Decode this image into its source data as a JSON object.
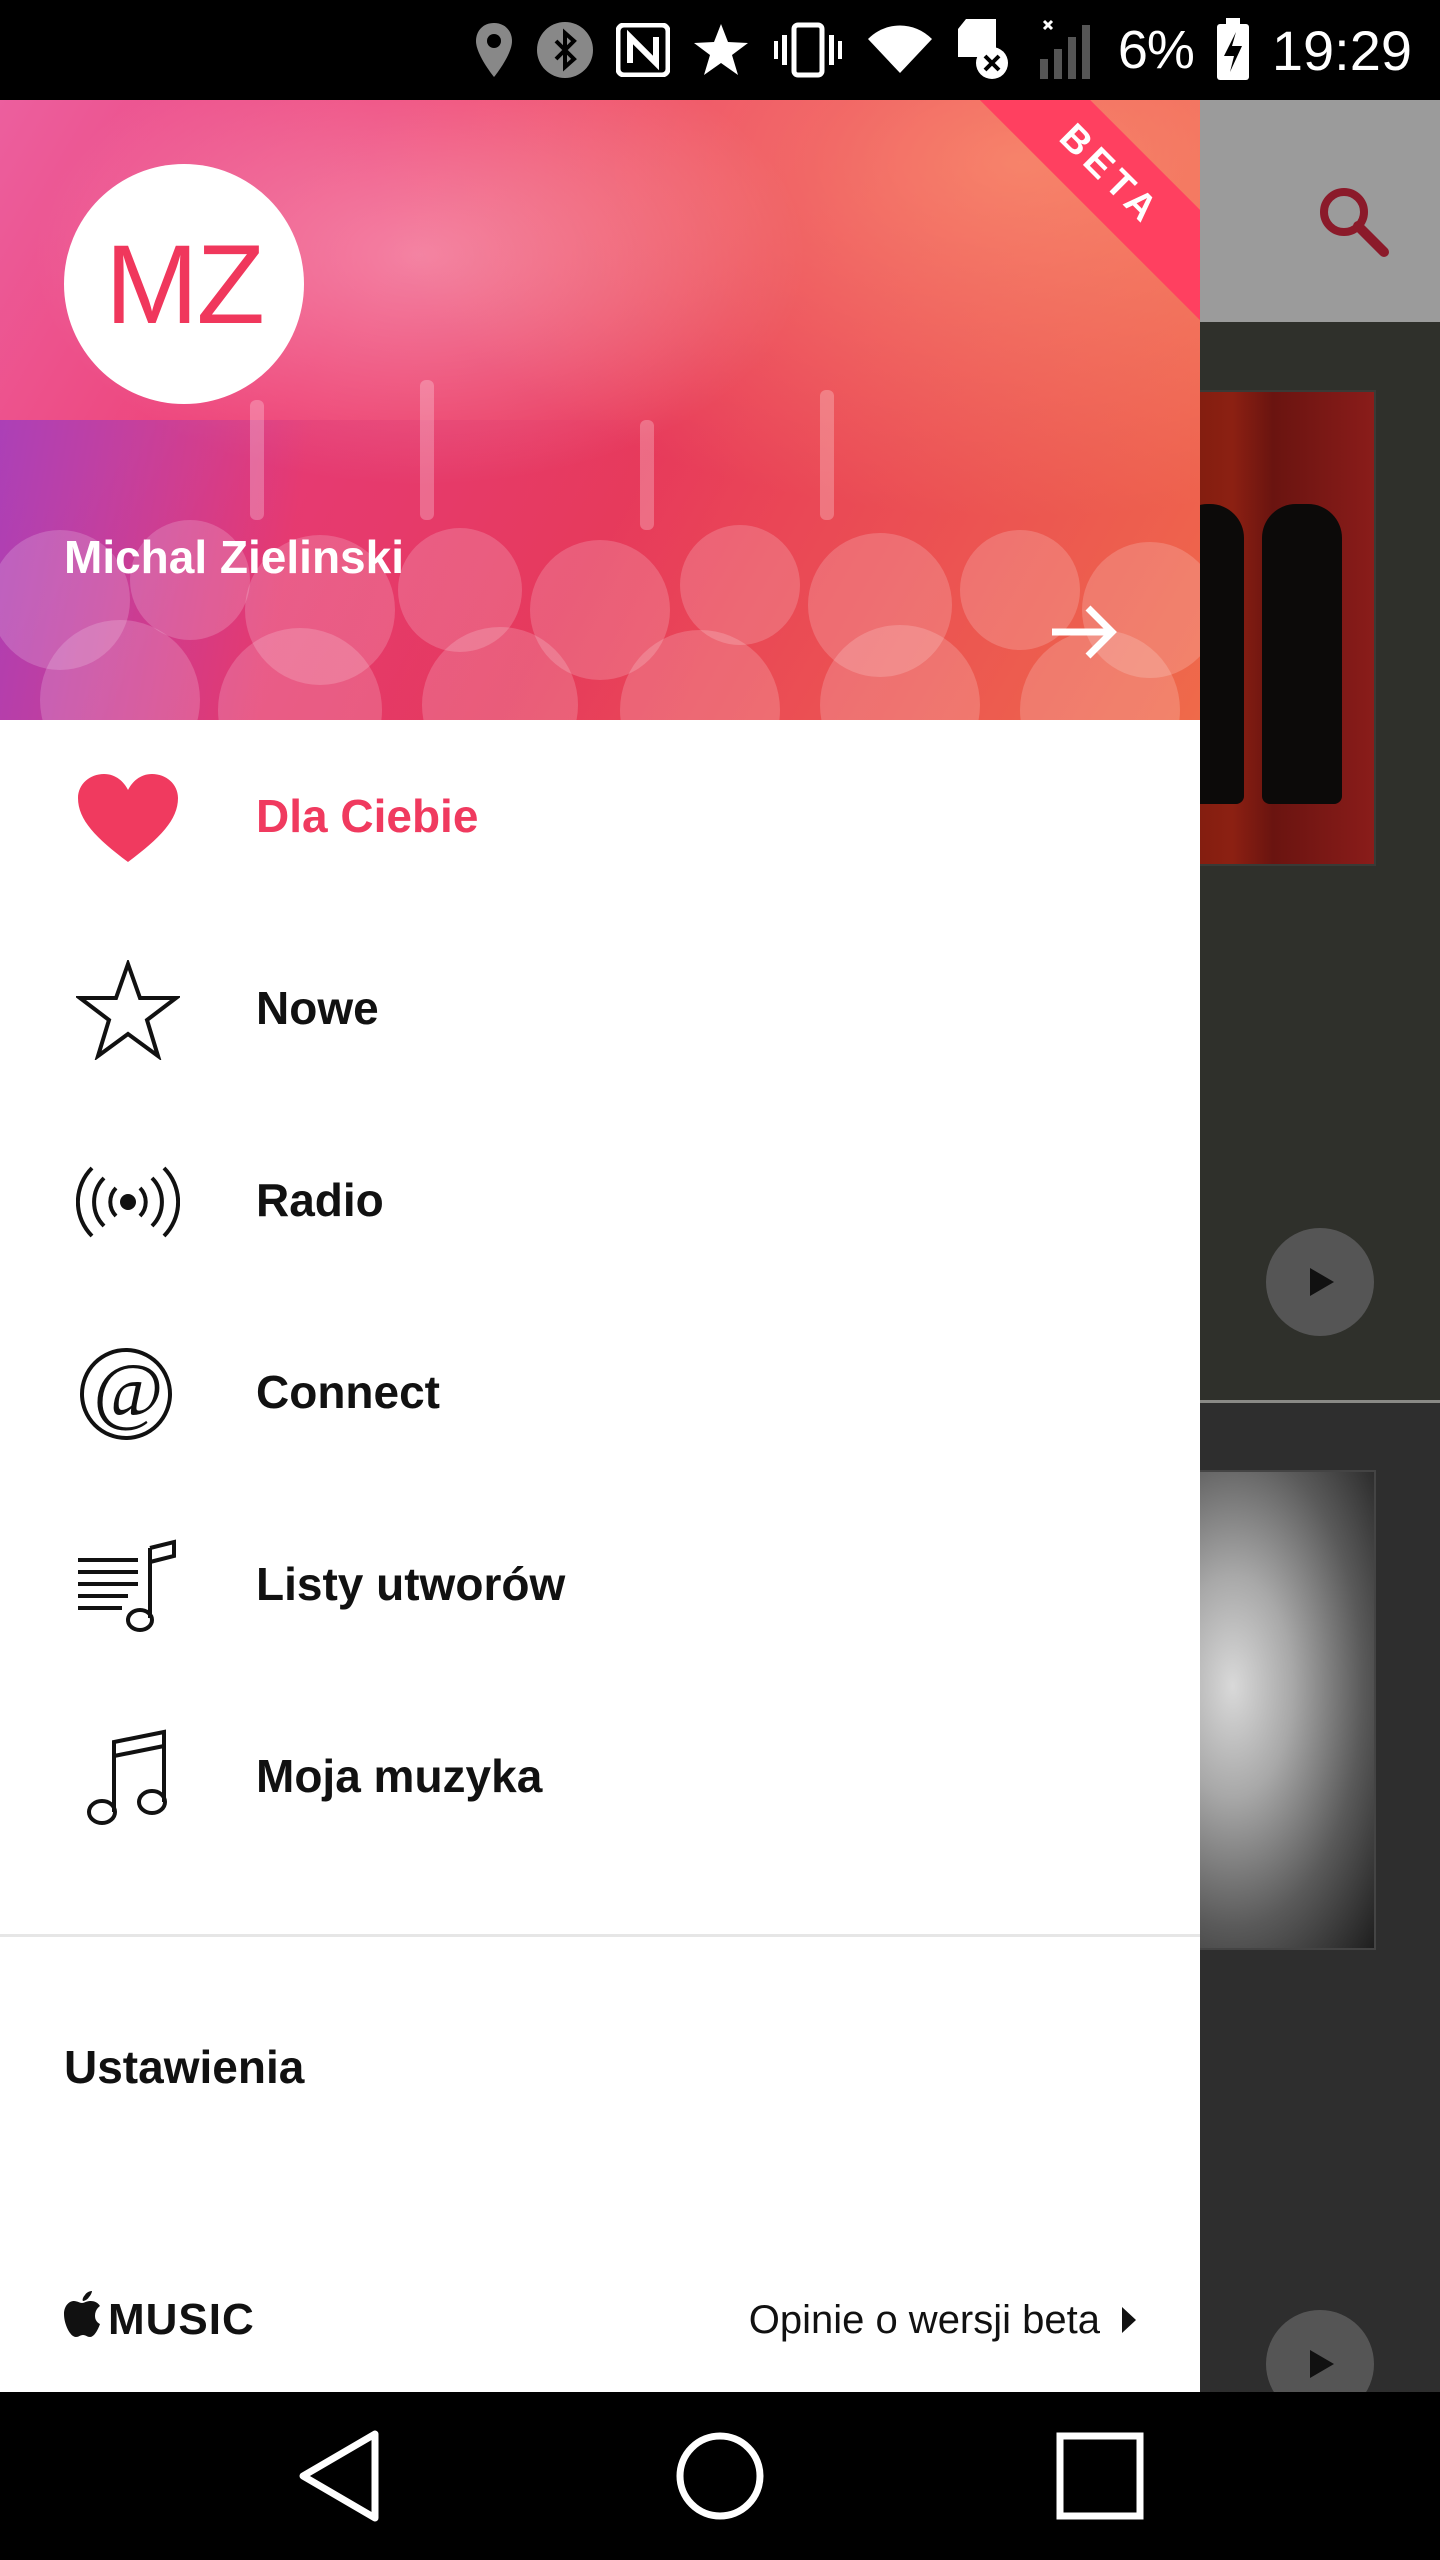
{
  "status_bar": {
    "battery": "6%",
    "time": "19:29",
    "icons": [
      "location-icon",
      "bluetooth-icon",
      "nfc-icon",
      "star-icon",
      "vibrate-icon",
      "wifi-icon",
      "sd-card-icon",
      "signal-icon",
      "battery-charging-icon"
    ]
  },
  "app": {
    "search_icon": "search-icon",
    "accent_color": "#8b1a2a"
  },
  "drawer": {
    "avatar_initials": "MZ",
    "user_name": "Michal Zielinski",
    "badge": "BETA",
    "menu": [
      {
        "label": "Dla Ciebie",
        "icon": "heart-icon",
        "active": true
      },
      {
        "label": "Nowe",
        "icon": "star-outline-icon",
        "active": false
      },
      {
        "label": "Radio",
        "icon": "radio-broadcast-icon",
        "active": false
      },
      {
        "label": "Connect",
        "icon": "at-sign-icon",
        "active": false
      },
      {
        "label": "Listy utworów",
        "icon": "playlist-icon",
        "active": false
      },
      {
        "label": "Moja muzyka",
        "icon": "music-note-icon",
        "active": false
      }
    ],
    "settings_label": "Ustawienia",
    "footer": {
      "brand": "MUSIC",
      "feedback_label": "Opinie o wersji beta"
    },
    "colors": {
      "accent": "#f03a5f",
      "text": "#111111"
    }
  },
  "nav_bar": {
    "buttons": [
      "back-icon",
      "home-icon",
      "recents-icon"
    ]
  }
}
